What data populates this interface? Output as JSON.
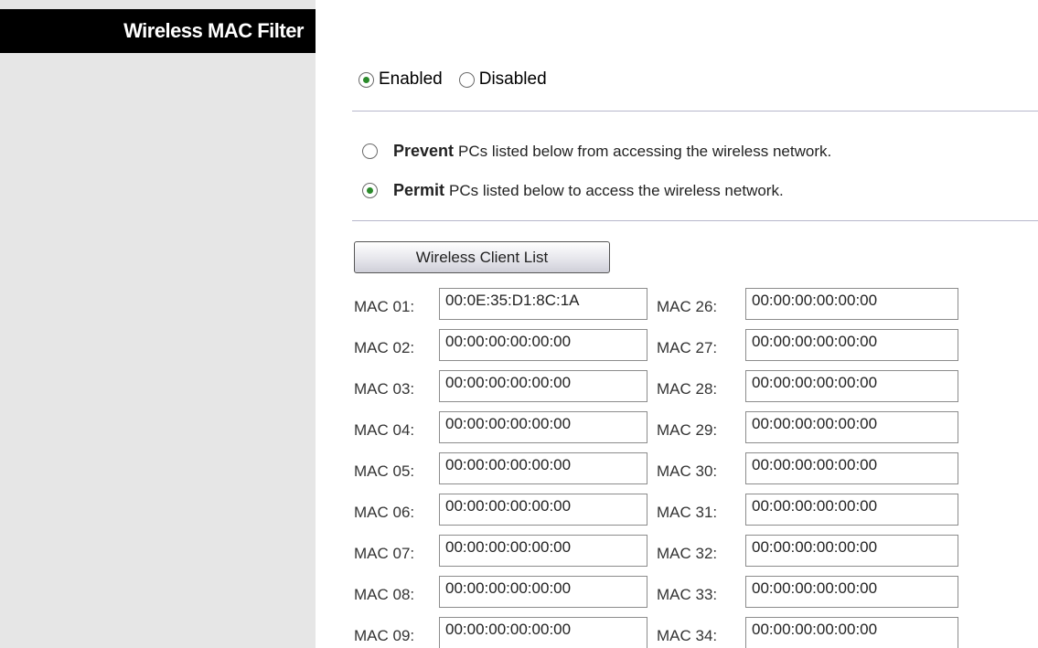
{
  "sidebar": {
    "title": "Wireless MAC Filter"
  },
  "enable": {
    "enabled_label": "Enabled",
    "disabled_label": "Disabled",
    "selected": "Enabled"
  },
  "access": {
    "prevent_bold": "Prevent",
    "prevent_text": "PCs listed below from accessing the wireless network.",
    "permit_bold": "Permit",
    "permit_text": "PCs listed below to access the wireless network.",
    "selected": "Permit"
  },
  "client_list_button": "Wireless Client List",
  "mac_rows": [
    {
      "left_label": "MAC 01:",
      "left_value": "00:0E:35:D1:8C:1A",
      "right_label": "MAC 26:",
      "right_value": "00:00:00:00:00:00"
    },
    {
      "left_label": "MAC 02:",
      "left_value": "00:00:00:00:00:00",
      "right_label": "MAC 27:",
      "right_value": "00:00:00:00:00:00"
    },
    {
      "left_label": "MAC 03:",
      "left_value": "00:00:00:00:00:00",
      "right_label": "MAC 28:",
      "right_value": "00:00:00:00:00:00"
    },
    {
      "left_label": "MAC 04:",
      "left_value": "00:00:00:00:00:00",
      "right_label": "MAC 29:",
      "right_value": "00:00:00:00:00:00"
    },
    {
      "left_label": "MAC 05:",
      "left_value": "00:00:00:00:00:00",
      "right_label": "MAC 30:",
      "right_value": "00:00:00:00:00:00"
    },
    {
      "left_label": "MAC 06:",
      "left_value": "00:00:00:00:00:00",
      "right_label": "MAC 31:",
      "right_value": "00:00:00:00:00:00"
    },
    {
      "left_label": "MAC 07:",
      "left_value": "00:00:00:00:00:00",
      "right_label": "MAC 32:",
      "right_value": "00:00:00:00:00:00"
    },
    {
      "left_label": "MAC 08:",
      "left_value": "00:00:00:00:00:00",
      "right_label": "MAC 33:",
      "right_value": "00:00:00:00:00:00"
    },
    {
      "left_label": "MAC 09:",
      "left_value": "00:00:00:00:00:00",
      "right_label": "MAC 34:",
      "right_value": "00:00:00:00:00:00"
    }
  ],
  "colors": {
    "sidebar_bg": "#e6e6e6",
    "header_bg": "#000000",
    "header_text": "#ffffff",
    "radio_dot": "#2a8a2a",
    "divider": "#b8b8cc"
  }
}
